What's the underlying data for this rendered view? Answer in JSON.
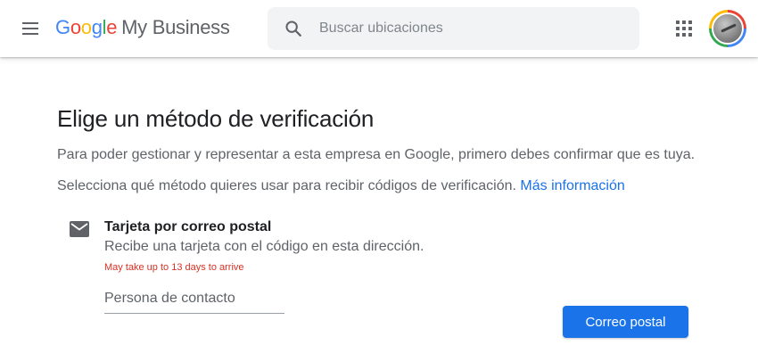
{
  "header": {
    "logo": {
      "letters": [
        {
          "char": "G",
          "color": "#4285f4"
        },
        {
          "char": "o",
          "color": "#ea4335"
        },
        {
          "char": "o",
          "color": "#fbbc05"
        },
        {
          "char": "g",
          "color": "#4285f4"
        },
        {
          "char": "l",
          "color": "#34a853"
        },
        {
          "char": "e",
          "color": "#ea4335"
        }
      ],
      "product": "My Business"
    },
    "search": {
      "placeholder": "Buscar ubicaciones",
      "value": ""
    },
    "icons": {
      "menu": "hamburger-menu-icon",
      "search": "search-icon",
      "apps": "apps-grid-icon",
      "account": "account-avatar"
    }
  },
  "main": {
    "title": "Elige un método de verificación",
    "description": "Para poder gestionar y representar a esta empresa en Google, primero debes confirmar que es tuya.",
    "instruction": "Selecciona qué método quieres usar para recibir códigos de verificación.",
    "more_info_link": "Más información",
    "option": {
      "icon": "mail-icon",
      "title": "Tarjeta por correo postal",
      "description": "Recibe una tarjeta con el código en esta dirección.",
      "warning": "May take up to 13 days to arrive",
      "contact_field": {
        "placeholder": "Persona de contacto",
        "value": ""
      }
    },
    "submit_label": "Correo postal"
  },
  "colors": {
    "accent": "#1a73e8",
    "warning": "#d93025",
    "text_primary": "#202124",
    "text_secondary": "#5f6368",
    "search_bg": "#f1f3f4"
  }
}
